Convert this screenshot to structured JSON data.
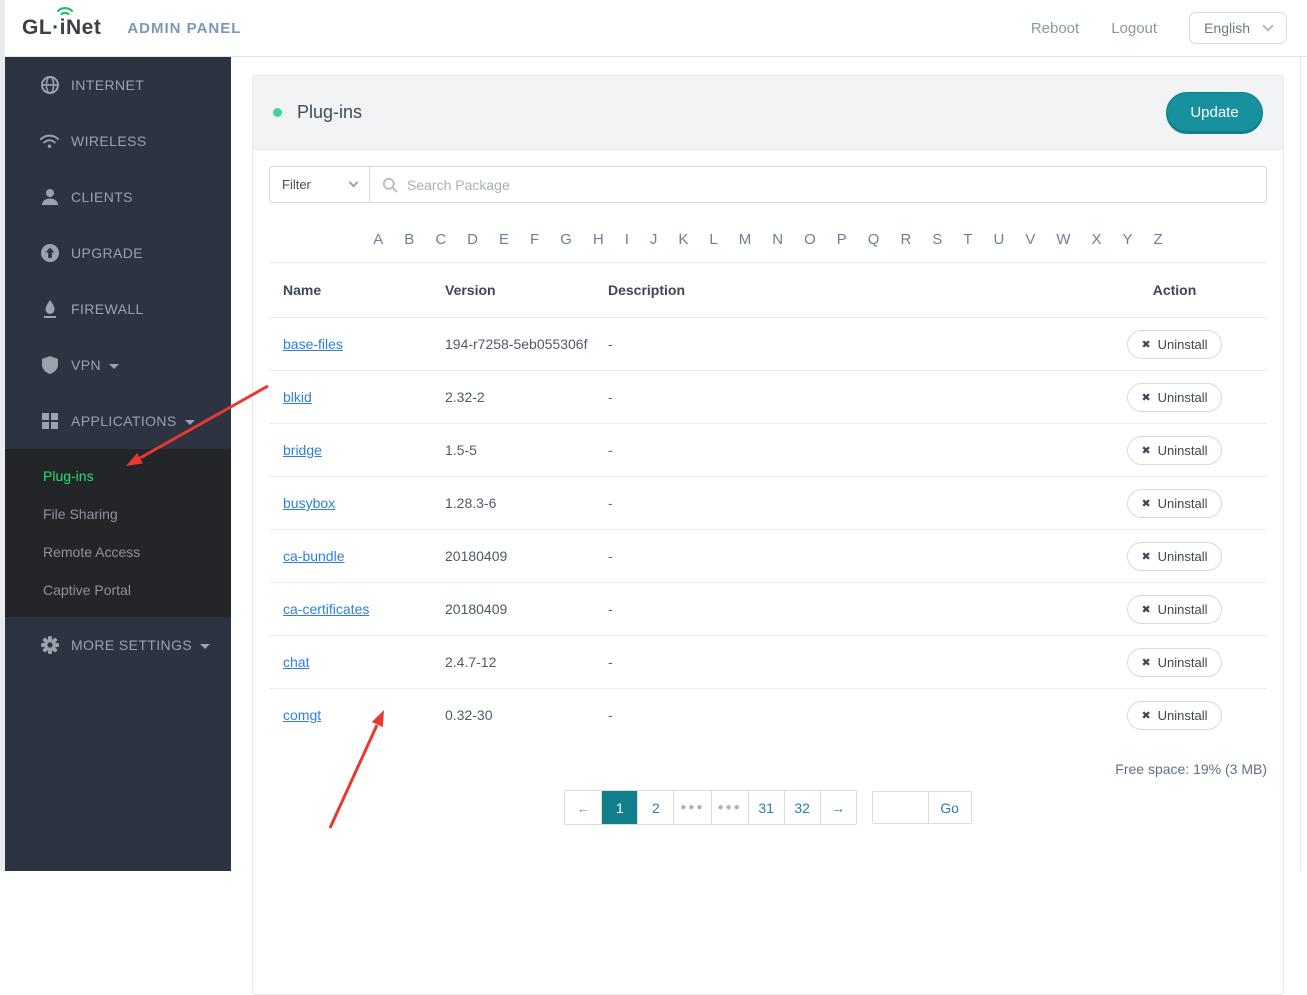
{
  "header": {
    "logo_prefix": "GL·",
    "logo_i": "i",
    "logo_suffix": "Net",
    "admin_title": "ADMIN PANEL",
    "reboot_label": "Reboot",
    "logout_label": "Logout",
    "language": "English"
  },
  "sidebar": {
    "items": [
      {
        "label": "INTERNET",
        "icon": "globe-icon"
      },
      {
        "label": "WIRELESS",
        "icon": "wifi-icon"
      },
      {
        "label": "CLIENTS",
        "icon": "user-icon"
      },
      {
        "label": "UPGRADE",
        "icon": "upload-circle-icon"
      },
      {
        "label": "FIREWALL",
        "icon": "flame-icon"
      },
      {
        "label": "VPN",
        "icon": "shield-icon",
        "caret": true
      },
      {
        "label": "APPLICATIONS",
        "icon": "grid-icon",
        "caret": true
      }
    ],
    "submenu": [
      {
        "label": "Plug-ins",
        "active": true
      },
      {
        "label": "File Sharing",
        "active": false
      },
      {
        "label": "Remote Access",
        "active": false
      },
      {
        "label": "Captive Portal",
        "active": false
      }
    ],
    "more_settings": {
      "label": "MORE SETTINGS",
      "icon": "gear-icon",
      "caret": true
    }
  },
  "page": {
    "title": "Plug-ins",
    "update_button": "Update",
    "filter_label": "Filter",
    "search_placeholder": "Search Package",
    "alphabet": [
      "A",
      "B",
      "C",
      "D",
      "E",
      "F",
      "G",
      "H",
      "I",
      "J",
      "K",
      "L",
      "M",
      "N",
      "O",
      "P",
      "Q",
      "R",
      "S",
      "T",
      "U",
      "V",
      "W",
      "X",
      "Y",
      "Z"
    ],
    "table": {
      "columns": [
        "Name",
        "Version",
        "Description",
        "Action"
      ],
      "uninstall_label": "Uninstall",
      "rows": [
        {
          "name": "base-files",
          "version": "194-r7258-5eb055306f",
          "description": "-"
        },
        {
          "name": "blkid",
          "version": "2.32-2",
          "description": "-"
        },
        {
          "name": "bridge",
          "version": "1.5-5",
          "description": "-"
        },
        {
          "name": "busybox",
          "version": "1.28.3-6",
          "description": "-"
        },
        {
          "name": "ca-bundle",
          "version": "20180409",
          "description": "-"
        },
        {
          "name": "ca-certificates",
          "version": "20180409",
          "description": "-"
        },
        {
          "name": "chat",
          "version": "2.4.7-12",
          "description": "-"
        },
        {
          "name": "comgt",
          "version": "0.32-30",
          "description": "-"
        }
      ]
    },
    "free_space": "Free space: 19% (3 MB)",
    "pagination": {
      "items": [
        "prev",
        "1",
        "2",
        "dots",
        "dots",
        "31",
        "32",
        "next"
      ],
      "active": "1",
      "go_label": "Go",
      "go_input_value": ""
    }
  },
  "icons": {
    "prev_glyph": "←",
    "next_glyph": "→",
    "dots_glyph": "●●●",
    "uninstall_glyph": "✖"
  },
  "colors": {
    "accent_teal": "#16919d",
    "active_green": "#21e26e",
    "link_blue": "#2e7fdc",
    "brand_green": "#1fc06a",
    "annotation_red": "#e8382f"
  }
}
